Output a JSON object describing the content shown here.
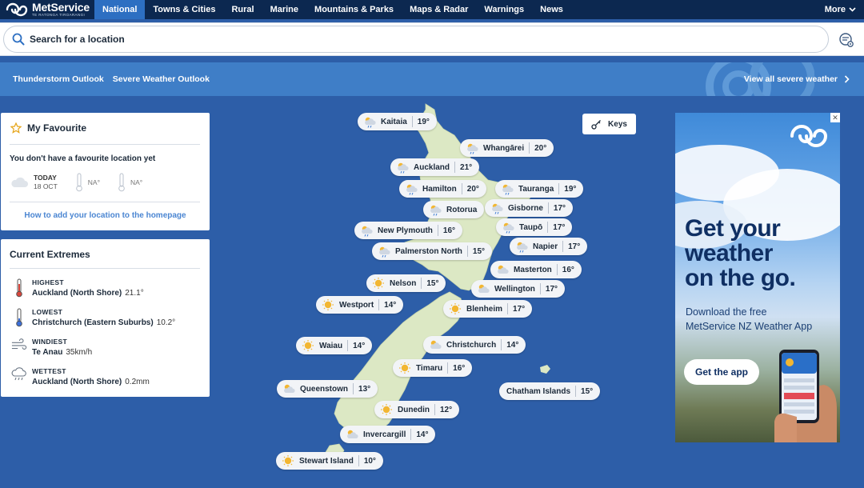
{
  "brand": {
    "name": "MetService",
    "tagline": "TE RATONGA TIROARANGI"
  },
  "nav": {
    "items": [
      "National",
      "Towns & Cities",
      "Rural",
      "Marine",
      "Mountains & Parks",
      "Maps & Radar",
      "Warnings",
      "News"
    ],
    "active": "National",
    "more": "More"
  },
  "search": {
    "placeholder": "Search for a location"
  },
  "outlook": {
    "links": [
      "Thunderstorm Outlook",
      "Severe Weather Outlook"
    ],
    "view_all": "View all severe weather"
  },
  "favourite": {
    "title": "My Favourite",
    "message": "You don't have a favourite location yet",
    "today_label": "TODAY",
    "today_date": "18 OCT",
    "high": "NA°",
    "low": "NA°",
    "link": "How to add your location to the homepage"
  },
  "extremes": {
    "title": "Current Extremes",
    "rows": [
      {
        "label": "HIGHEST",
        "location": "Auckland (North Shore)",
        "value": "21.1°",
        "icon": "thermometer-hot-icon"
      },
      {
        "label": "LOWEST",
        "location": "Christchurch (Eastern Suburbs)",
        "value": "10.2°",
        "icon": "thermometer-cold-icon"
      },
      {
        "label": "WINDIEST",
        "location": "Te Anau",
        "value": "35km/h",
        "icon": "wind-icon"
      },
      {
        "label": "WETTEST",
        "location": "Auckland (North Shore)",
        "value": "0.2mm",
        "icon": "rain-icon"
      }
    ]
  },
  "keys": {
    "label": "Keys"
  },
  "map": {
    "locations": [
      {
        "name": "Kaitaia",
        "temp": "19°",
        "icon": "partly-cloudy-rain-icon"
      },
      {
        "name": "Whangārei",
        "temp": "20°",
        "icon": "partly-cloudy-rain-icon"
      },
      {
        "name": "Auckland",
        "temp": "21°",
        "icon": "partly-cloudy-rain-icon"
      },
      {
        "name": "Hamilton",
        "temp": "20°",
        "icon": "partly-cloudy-rain-icon"
      },
      {
        "name": "Tauranga",
        "temp": "19°",
        "icon": "partly-cloudy-rain-icon"
      },
      {
        "name": "Rotorua",
        "temp": "",
        "icon": "partly-cloudy-rain-icon"
      },
      {
        "name": "Gisborne",
        "temp": "17°",
        "icon": "partly-cloudy-rain-icon"
      },
      {
        "name": "New Plymouth",
        "temp": "16°",
        "icon": "partly-cloudy-rain-icon"
      },
      {
        "name": "Taupō",
        "temp": "17°",
        "icon": "partly-cloudy-rain-icon"
      },
      {
        "name": "Palmerston North",
        "temp": "15°",
        "icon": "partly-cloudy-rain-icon"
      },
      {
        "name": "Napier",
        "temp": "17°",
        "icon": "partly-cloudy-rain-icon"
      },
      {
        "name": "Masterton",
        "temp": "16°",
        "icon": "partly-cloudy-icon"
      },
      {
        "name": "Nelson",
        "temp": "15°",
        "icon": "sunny-icon"
      },
      {
        "name": "Wellington",
        "temp": "17°",
        "icon": "partly-cloudy-icon"
      },
      {
        "name": "Westport",
        "temp": "14°",
        "icon": "sunny-icon"
      },
      {
        "name": "Blenheim",
        "temp": "17°",
        "icon": "sunny-icon"
      },
      {
        "name": "Waiau",
        "temp": "14°",
        "icon": "sunny-icon"
      },
      {
        "name": "Christchurch",
        "temp": "14°",
        "icon": "partly-cloudy-icon"
      },
      {
        "name": "Timaru",
        "temp": "16°",
        "icon": "sunny-icon"
      },
      {
        "name": "Queenstown",
        "temp": "13°",
        "icon": "partly-cloudy-icon"
      },
      {
        "name": "Chatham Islands",
        "temp": "15°",
        "icon": "none"
      },
      {
        "name": "Dunedin",
        "temp": "12°",
        "icon": "sunny-icon"
      },
      {
        "name": "Invercargill",
        "temp": "14°",
        "icon": "partly-cloudy-icon"
      },
      {
        "name": "Stewart Island",
        "temp": "10°",
        "icon": "sunny-icon"
      }
    ]
  },
  "ad": {
    "headline": [
      "Get your",
      "weather",
      "on the go."
    ],
    "sub": [
      "Download the free",
      "MetService NZ Weather App"
    ],
    "button": "Get the app"
  },
  "colors": {
    "nav_bg": "#0c2850",
    "nav_active": "#2d6fc2",
    "page_bg": "#2d5ea8",
    "land": "#dce8c4",
    "accent_link": "#4b86d2",
    "ad_text": "#0f2f63"
  }
}
